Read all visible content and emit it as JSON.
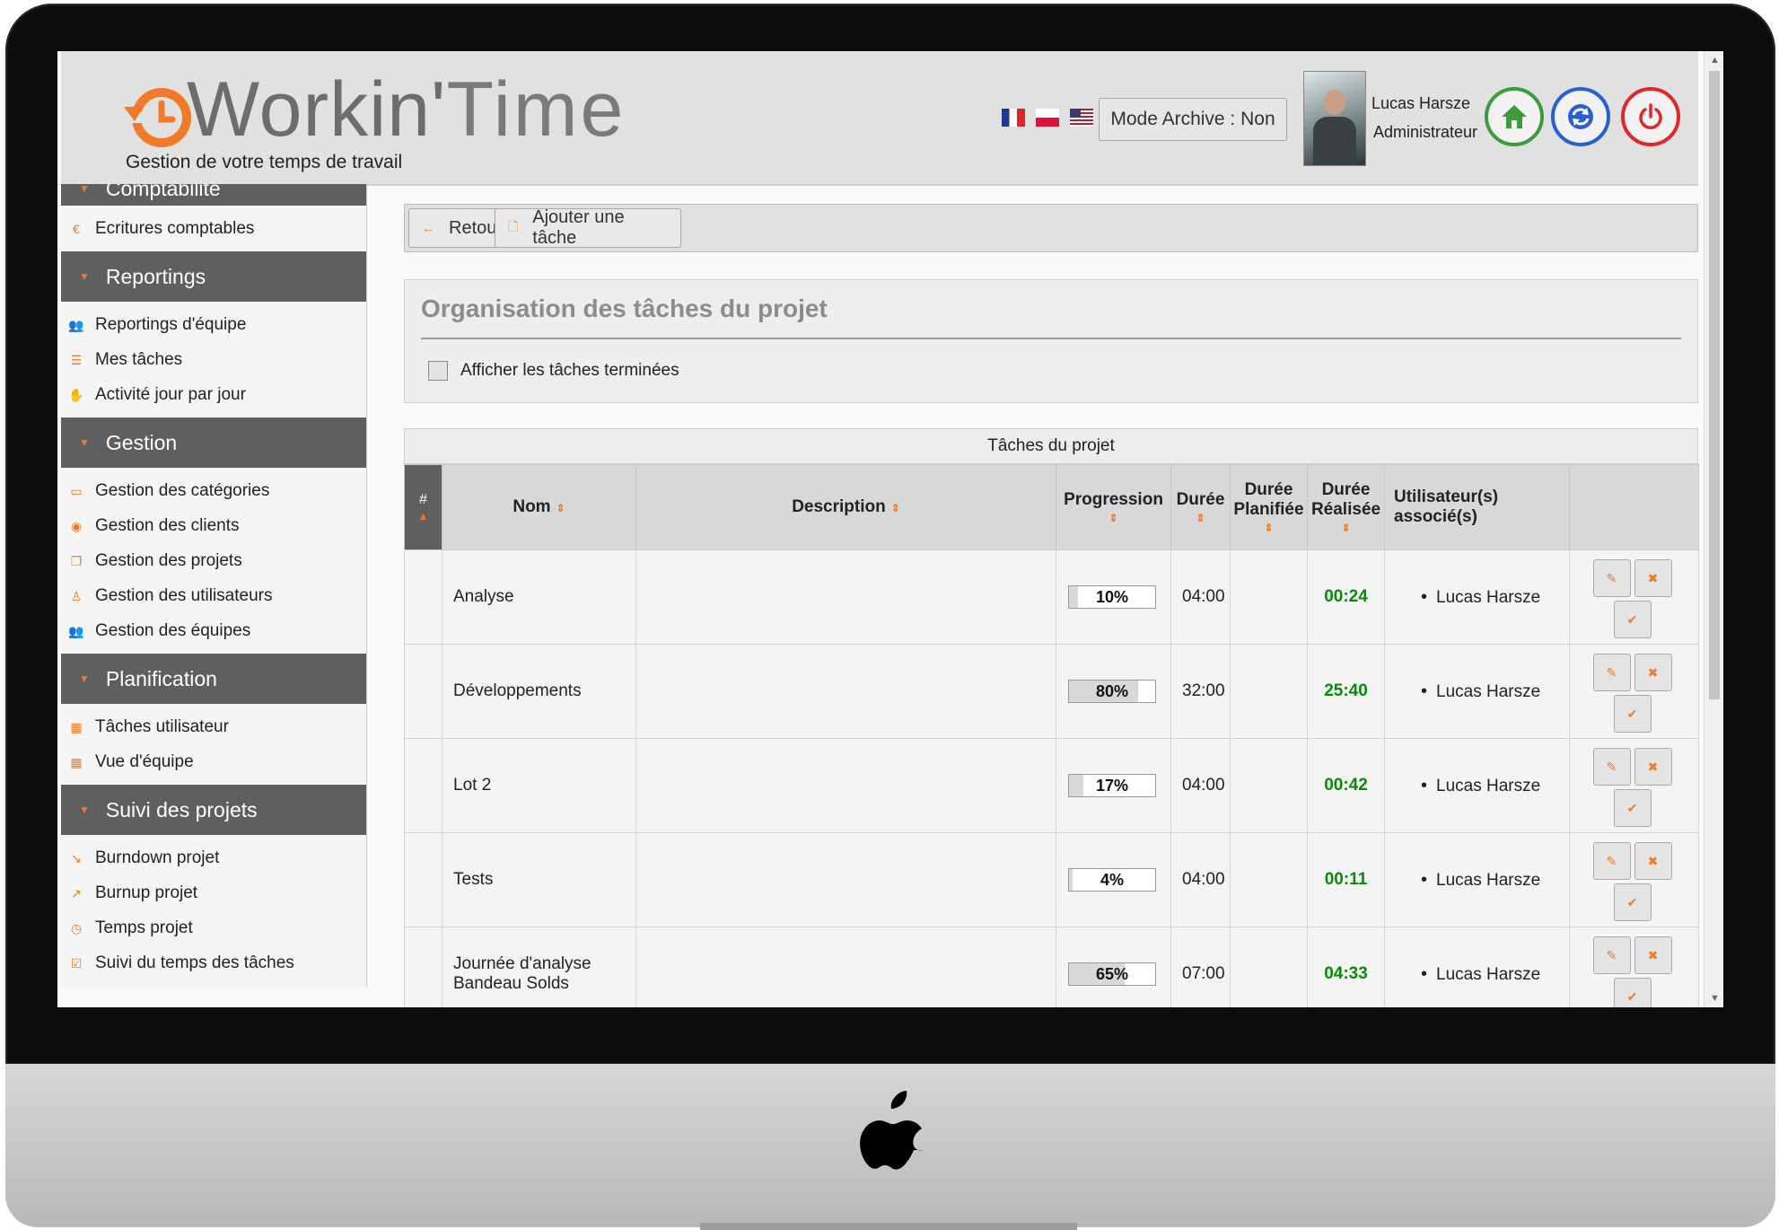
{
  "app": {
    "brand_part1": "Workin'",
    "brand_part2": "Time",
    "tagline": "Gestion de votre temps de travail"
  },
  "header": {
    "archive_button": "Mode Archive : Non",
    "user_name": "Lucas Harsze",
    "user_role": "Administrateur",
    "flags": [
      "fr-flag",
      "pl-flag",
      "us-flag"
    ]
  },
  "sidebar": {
    "sections": [
      {
        "title": "Comptabilité",
        "items": [
          {
            "label": "Ecritures comptables",
            "icon": "euro-icon"
          }
        ]
      },
      {
        "title": "Reportings",
        "items": [
          {
            "label": "Reportings d'équipe",
            "icon": "team-icon"
          },
          {
            "label": "Mes tâches",
            "icon": "list-icon"
          },
          {
            "label": "Activité jour par jour",
            "icon": "hand-icon"
          }
        ]
      },
      {
        "title": "Gestion",
        "items": [
          {
            "label": "Gestion des catégories",
            "icon": "folder-icon"
          },
          {
            "label": "Gestion des clients",
            "icon": "user-circle-icon"
          },
          {
            "label": "Gestion des projets",
            "icon": "copy-icon"
          },
          {
            "label": "Gestion des utilisateurs",
            "icon": "user-icon"
          },
          {
            "label": "Gestion des équipes",
            "icon": "team-icon"
          }
        ]
      },
      {
        "title": "Planification",
        "items": [
          {
            "label": "Tâches utilisateur",
            "icon": "calendar-icon"
          },
          {
            "label": "Vue d'équipe",
            "icon": "calendar-icon"
          }
        ]
      },
      {
        "title": "Suivi des projets",
        "items": [
          {
            "label": "Burndown projet",
            "icon": "chart-down-icon"
          },
          {
            "label": "Burnup projet",
            "icon": "chart-up-icon"
          },
          {
            "label": "Temps projet",
            "icon": "clock-icon"
          },
          {
            "label": "Suivi du temps des tâches",
            "icon": "calendar-check-icon"
          }
        ]
      }
    ]
  },
  "toolbar": {
    "back_label": "Retour",
    "add_task_label": "Ajouter une tâche"
  },
  "panel": {
    "title": "Organisation des tâches du projet",
    "show_done_label": "Afficher les tâches terminées",
    "show_done_checked": false
  },
  "table": {
    "caption": "Tâches du projet",
    "headers": {
      "hash": "#",
      "nom": "Nom",
      "description": "Description",
      "progression": "Progression",
      "duree": "Durée",
      "duree_planifiee_1": "Durée",
      "duree_planifiee_2": "Planifiée",
      "duree_realisee_1": "Durée",
      "duree_realisee_2": "Réalisée",
      "users_1": "Utilisateur(s)",
      "users_2": "associé(s)"
    },
    "rows": [
      {
        "name": "Analyse",
        "name2": "",
        "description": "",
        "progress_pct": 10,
        "progress_label": "10%",
        "duration": "04:00",
        "planned": "",
        "realized": "00:24",
        "user": "Lucas Harsze"
      },
      {
        "name": "Développements",
        "name2": "",
        "description": "",
        "progress_pct": 80,
        "progress_label": "80%",
        "duration": "32:00",
        "planned": "",
        "realized": "25:40",
        "user": "Lucas Harsze"
      },
      {
        "name": "Lot 2",
        "name2": "",
        "description": "",
        "progress_pct": 17,
        "progress_label": "17%",
        "duration": "04:00",
        "planned": "",
        "realized": "00:42",
        "user": "Lucas Harsze"
      },
      {
        "name": "Tests",
        "name2": "",
        "description": "",
        "progress_pct": 4,
        "progress_label": "4%",
        "duration": "04:00",
        "planned": "",
        "realized": "00:11",
        "user": "Lucas Harsze"
      },
      {
        "name": "Journée d'analyse",
        "name2": "Bandeau Solds",
        "description": "",
        "progress_pct": 65,
        "progress_label": "65%",
        "duration": "07:00",
        "planned": "",
        "realized": "04:33",
        "user": "Lucas Harsze"
      }
    ]
  },
  "colors": {
    "accent": "#f07a2a",
    "realized_green": "#0a8a0a",
    "section_header": "#5f5f5f",
    "home_green": "#3d9a3d",
    "sync_blue": "#2a5fd1",
    "power_red": "#e0282a"
  }
}
